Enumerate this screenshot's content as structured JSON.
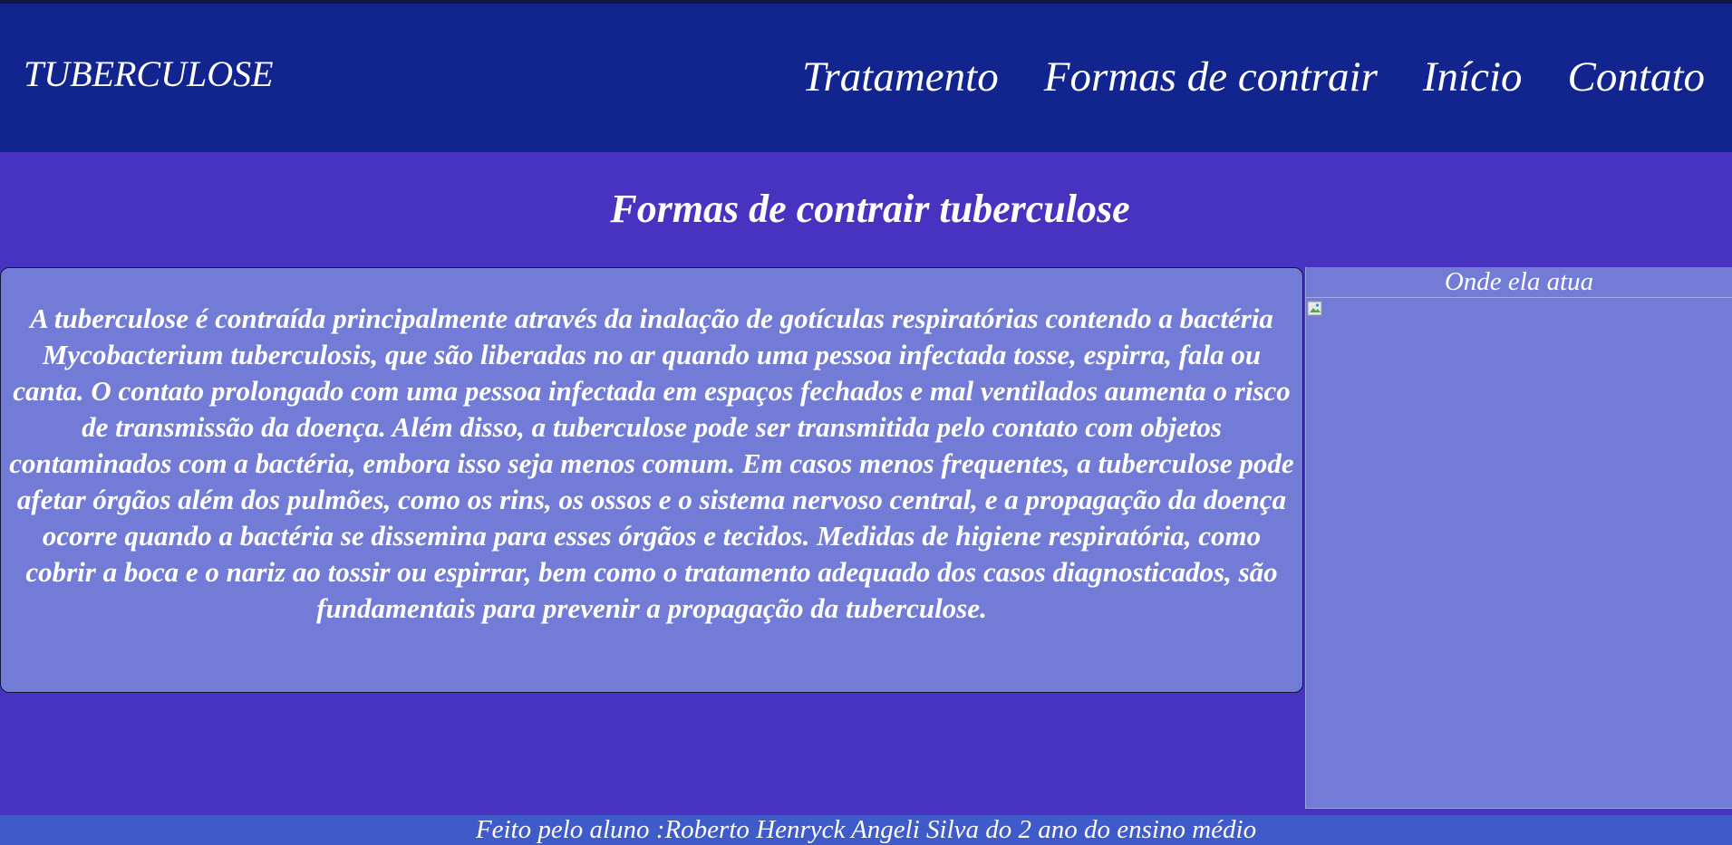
{
  "header": {
    "logo_text": "TUBERCULOSE",
    "nav": [
      {
        "label": "Tratamento"
      },
      {
        "label": "Formas de contrair"
      },
      {
        "label": "Início"
      },
      {
        "label": "Contato"
      }
    ]
  },
  "main": {
    "heading": "Formas de contrair tuberculose",
    "body_text": "A tuberculose é contraída principalmente através da inalação de gotículas respiratórias contendo a bactéria Mycobacterium tuberculosis, que são liberadas no ar quando uma pessoa infectada tosse, espirra, fala ou canta. O contato prolongado com uma pessoa infectada em espaços fechados e mal ventilados aumenta o risco de transmissão da doença. Além disso, a tuberculose pode ser transmitida pelo contato com objetos contaminados com a bactéria, embora isso seja menos comum. Em casos menos frequentes, a tuberculose pode afetar órgãos além dos pulmões, como os rins, os ossos e o sistema nervoso central, e a propagação da doença ocorre quando a bactéria se dissemina para esses órgãos e tecidos. Medidas de higiene respiratória, como cobrir a boca e o nariz ao tossir ou espirrar, bem como o tratamento adequado dos casos diagnosticados, são fundamentais para prevenir a propagação da tuberculose."
  },
  "aside": {
    "title": "Onde ela atua",
    "image_icon": "broken-image-icon"
  },
  "footer": {
    "text": "Feito pelo aluno :Roberto Henryck Angeli Silva do 2 ano do ensino médio"
  },
  "colors": {
    "header_bg": "#12248e",
    "page_bg": "#4833c0",
    "box_bg": "#727bd6",
    "footer_bg": "#3f5bc9",
    "text": "#ffffff"
  }
}
